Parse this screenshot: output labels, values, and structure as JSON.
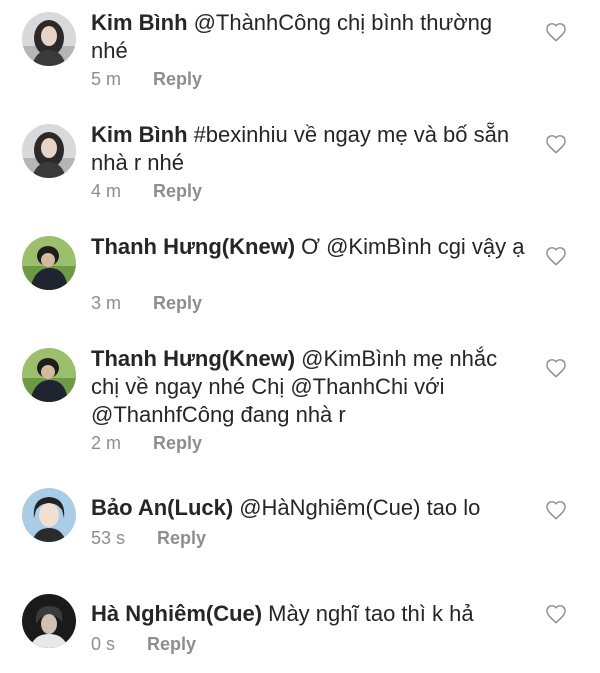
{
  "comments": [
    {
      "username": "Kim Bình",
      "text": "@ThànhCông chị bình thường nhé",
      "time": "5 m",
      "reply_label": "Reply",
      "avatar": "avatar-kim-binh",
      "like_icon": "heart-outline-icon"
    },
    {
      "username": "Kim Bình",
      "text": "#bexinhiu về ngay mẹ và bố sẵn nhà r nhé",
      "time": "4 m",
      "reply_label": "Reply",
      "avatar": "avatar-kim-binh",
      "like_icon": "heart-outline-icon"
    },
    {
      "username": "Thanh Hưng(Knew)",
      "text": "Ơ @KimBình cgi vậy ạ",
      "time": "3 m",
      "reply_label": "Reply",
      "avatar": "avatar-thanh-hung",
      "like_icon": "heart-outline-icon"
    },
    {
      "username": "Thanh Hưng(Knew)",
      "text": "@KimBình mẹ nhắc chị về ngay nhé Chị @ThanhChi với @ThanhfCông đang nhà r",
      "time": "2 m",
      "reply_label": "Reply",
      "avatar": "avatar-thanh-hung",
      "like_icon": "heart-outline-icon"
    },
    {
      "username": "Bảo An(Luck)",
      "text": "@HàNghiêm(Cue) tao lo",
      "time": "53 s",
      "reply_label": "Reply",
      "avatar": "avatar-bao-an",
      "like_icon": "heart-outline-icon"
    },
    {
      "username": "Hà Nghiêm(Cue)",
      "text": "Mày nghĩ tao thì k hả",
      "time": "0 s",
      "reply_label": "Reply",
      "avatar": "avatar-ha-nghiem",
      "like_icon": "heart-outline-icon"
    }
  ]
}
